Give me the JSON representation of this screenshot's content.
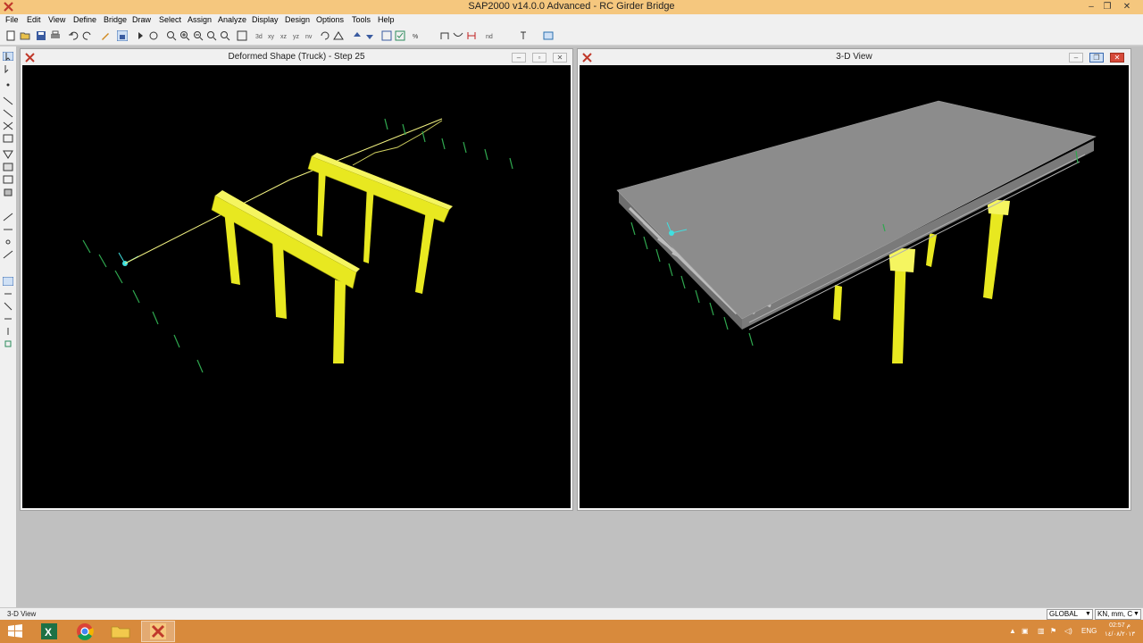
{
  "app": {
    "title": "SAP2000 v14.0.0 Advanced  - RC Girder Bridge",
    "window_controls": [
      "–",
      "❐",
      "✕"
    ]
  },
  "menu": [
    "File",
    "Edit",
    "View",
    "Define",
    "Bridge",
    "Draw",
    "Select",
    "Assign",
    "Analyze",
    "Display",
    "Design",
    "Options",
    "Tools",
    "Help"
  ],
  "windows": {
    "left": {
      "title": "Deformed Shape (Truck) - Step 25"
    },
    "right": {
      "title": "3-D View"
    }
  },
  "status": {
    "text": "3-D View",
    "coord_system": "GLOBAL",
    "units": "KN, mm, C"
  },
  "taskbar": {
    "apps": [
      "start-icon",
      "excel-icon",
      "chrome-icon",
      "file-explorer-icon",
      "sap2000-icon"
    ],
    "lang": "ENG",
    "time": "02:57 م",
    "date": "١٤/٠٨/٢٠١٣"
  },
  "colors": {
    "titlebar": "#f5c77e",
    "taskbar": "#d88a3c",
    "member": "#e8e820",
    "restraint": "#2fa84f",
    "deck": "#8c8c8c",
    "viewport_bg": "#000000"
  }
}
